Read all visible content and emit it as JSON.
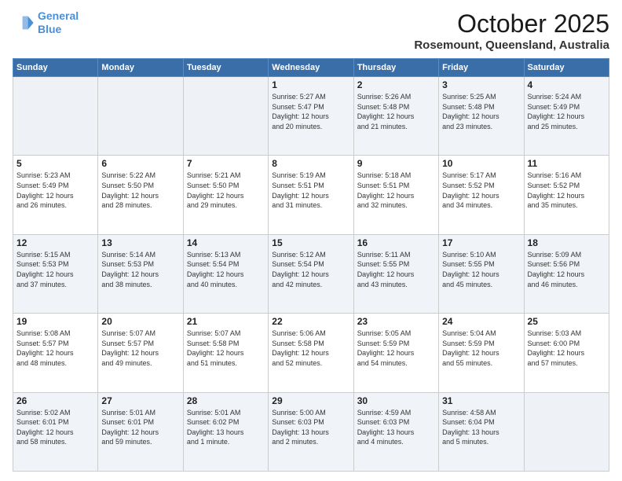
{
  "header": {
    "logo_line1": "General",
    "logo_line2": "Blue",
    "month": "October 2025",
    "location": "Rosemount, Queensland, Australia"
  },
  "days_of_week": [
    "Sunday",
    "Monday",
    "Tuesday",
    "Wednesday",
    "Thursday",
    "Friday",
    "Saturday"
  ],
  "weeks": [
    [
      {
        "day": "",
        "info": ""
      },
      {
        "day": "",
        "info": ""
      },
      {
        "day": "",
        "info": ""
      },
      {
        "day": "1",
        "info": "Sunrise: 5:27 AM\nSunset: 5:47 PM\nDaylight: 12 hours\nand 20 minutes."
      },
      {
        "day": "2",
        "info": "Sunrise: 5:26 AM\nSunset: 5:48 PM\nDaylight: 12 hours\nand 21 minutes."
      },
      {
        "day": "3",
        "info": "Sunrise: 5:25 AM\nSunset: 5:48 PM\nDaylight: 12 hours\nand 23 minutes."
      },
      {
        "day": "4",
        "info": "Sunrise: 5:24 AM\nSunset: 5:49 PM\nDaylight: 12 hours\nand 25 minutes."
      }
    ],
    [
      {
        "day": "5",
        "info": "Sunrise: 5:23 AM\nSunset: 5:49 PM\nDaylight: 12 hours\nand 26 minutes."
      },
      {
        "day": "6",
        "info": "Sunrise: 5:22 AM\nSunset: 5:50 PM\nDaylight: 12 hours\nand 28 minutes."
      },
      {
        "day": "7",
        "info": "Sunrise: 5:21 AM\nSunset: 5:50 PM\nDaylight: 12 hours\nand 29 minutes."
      },
      {
        "day": "8",
        "info": "Sunrise: 5:19 AM\nSunset: 5:51 PM\nDaylight: 12 hours\nand 31 minutes."
      },
      {
        "day": "9",
        "info": "Sunrise: 5:18 AM\nSunset: 5:51 PM\nDaylight: 12 hours\nand 32 minutes."
      },
      {
        "day": "10",
        "info": "Sunrise: 5:17 AM\nSunset: 5:52 PM\nDaylight: 12 hours\nand 34 minutes."
      },
      {
        "day": "11",
        "info": "Sunrise: 5:16 AM\nSunset: 5:52 PM\nDaylight: 12 hours\nand 35 minutes."
      }
    ],
    [
      {
        "day": "12",
        "info": "Sunrise: 5:15 AM\nSunset: 5:53 PM\nDaylight: 12 hours\nand 37 minutes."
      },
      {
        "day": "13",
        "info": "Sunrise: 5:14 AM\nSunset: 5:53 PM\nDaylight: 12 hours\nand 38 minutes."
      },
      {
        "day": "14",
        "info": "Sunrise: 5:13 AM\nSunset: 5:54 PM\nDaylight: 12 hours\nand 40 minutes."
      },
      {
        "day": "15",
        "info": "Sunrise: 5:12 AM\nSunset: 5:54 PM\nDaylight: 12 hours\nand 42 minutes."
      },
      {
        "day": "16",
        "info": "Sunrise: 5:11 AM\nSunset: 5:55 PM\nDaylight: 12 hours\nand 43 minutes."
      },
      {
        "day": "17",
        "info": "Sunrise: 5:10 AM\nSunset: 5:55 PM\nDaylight: 12 hours\nand 45 minutes."
      },
      {
        "day": "18",
        "info": "Sunrise: 5:09 AM\nSunset: 5:56 PM\nDaylight: 12 hours\nand 46 minutes."
      }
    ],
    [
      {
        "day": "19",
        "info": "Sunrise: 5:08 AM\nSunset: 5:57 PM\nDaylight: 12 hours\nand 48 minutes."
      },
      {
        "day": "20",
        "info": "Sunrise: 5:07 AM\nSunset: 5:57 PM\nDaylight: 12 hours\nand 49 minutes."
      },
      {
        "day": "21",
        "info": "Sunrise: 5:07 AM\nSunset: 5:58 PM\nDaylight: 12 hours\nand 51 minutes."
      },
      {
        "day": "22",
        "info": "Sunrise: 5:06 AM\nSunset: 5:58 PM\nDaylight: 12 hours\nand 52 minutes."
      },
      {
        "day": "23",
        "info": "Sunrise: 5:05 AM\nSunset: 5:59 PM\nDaylight: 12 hours\nand 54 minutes."
      },
      {
        "day": "24",
        "info": "Sunrise: 5:04 AM\nSunset: 5:59 PM\nDaylight: 12 hours\nand 55 minutes."
      },
      {
        "day": "25",
        "info": "Sunrise: 5:03 AM\nSunset: 6:00 PM\nDaylight: 12 hours\nand 57 minutes."
      }
    ],
    [
      {
        "day": "26",
        "info": "Sunrise: 5:02 AM\nSunset: 6:01 PM\nDaylight: 12 hours\nand 58 minutes."
      },
      {
        "day": "27",
        "info": "Sunrise: 5:01 AM\nSunset: 6:01 PM\nDaylight: 12 hours\nand 59 minutes."
      },
      {
        "day": "28",
        "info": "Sunrise: 5:01 AM\nSunset: 6:02 PM\nDaylight: 13 hours\nand 1 minute."
      },
      {
        "day": "29",
        "info": "Sunrise: 5:00 AM\nSunset: 6:03 PM\nDaylight: 13 hours\nand 2 minutes."
      },
      {
        "day": "30",
        "info": "Sunrise: 4:59 AM\nSunset: 6:03 PM\nDaylight: 13 hours\nand 4 minutes."
      },
      {
        "day": "31",
        "info": "Sunrise: 4:58 AM\nSunset: 6:04 PM\nDaylight: 13 hours\nand 5 minutes."
      },
      {
        "day": "",
        "info": ""
      }
    ]
  ]
}
